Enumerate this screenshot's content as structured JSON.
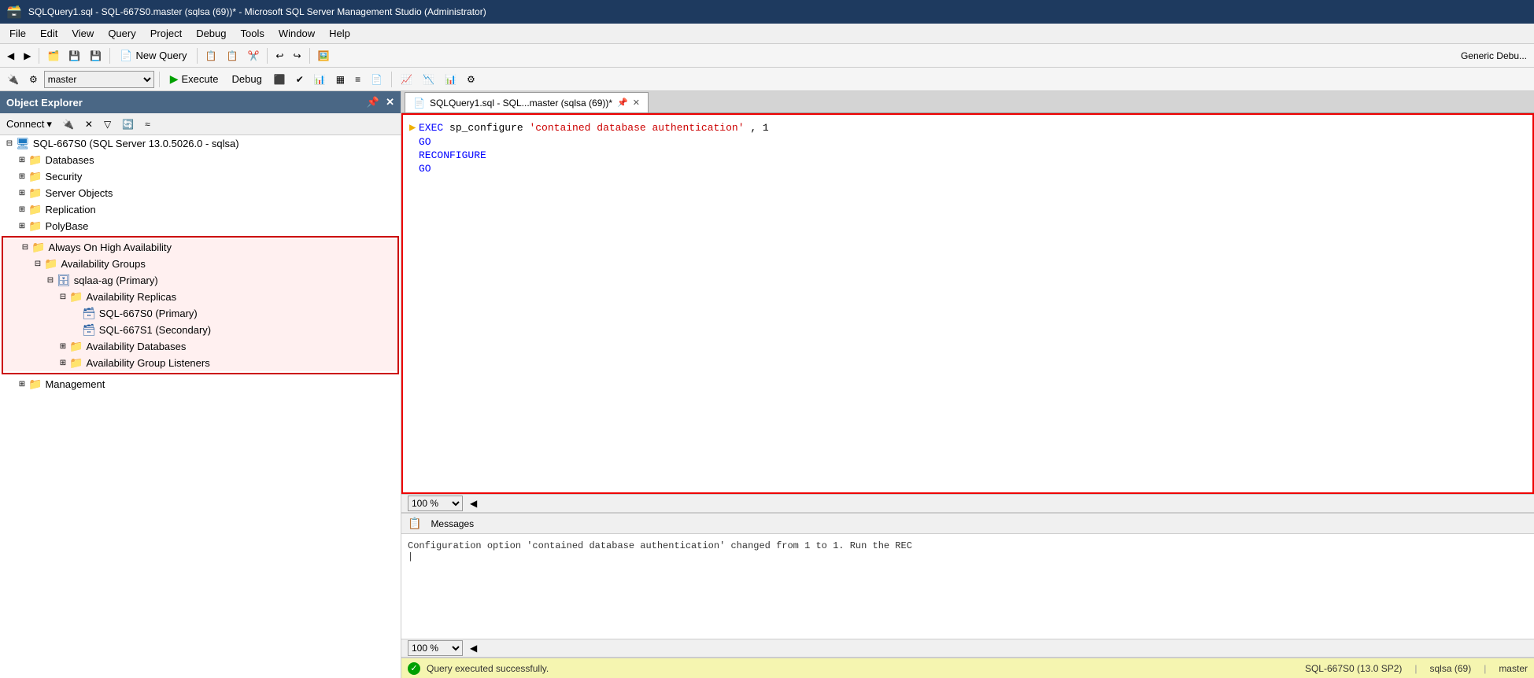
{
  "titleBar": {
    "text": "SQLQuery1.sql - SQL-667S0.master (sqlsa (69))* - Microsoft SQL Server Management Studio (Administrator)"
  },
  "menuBar": {
    "items": [
      "File",
      "Edit",
      "View",
      "Query",
      "Project",
      "Debug",
      "Tools",
      "Window",
      "Help"
    ]
  },
  "toolbar1": {
    "newQueryLabel": "New Query",
    "genericDebug": "Generic Debu..."
  },
  "toolbar2": {
    "database": "master",
    "executeLabel": "Execute",
    "debugLabel": "Debug"
  },
  "objectExplorer": {
    "title": "Object Explorer",
    "connectLabel": "Connect",
    "tree": {
      "serverNode": "SQL-667S0 (SQL Server 13.0.5026.0 - sqlsa)",
      "items": [
        {
          "label": "Databases",
          "indent": 2,
          "expanded": false
        },
        {
          "label": "Security",
          "indent": 2,
          "expanded": false
        },
        {
          "label": "Server Objects",
          "indent": 2,
          "expanded": false
        },
        {
          "label": "Replication",
          "indent": 2,
          "expanded": false
        },
        {
          "label": "PolyBase",
          "indent": 2,
          "expanded": false
        },
        {
          "label": "Always On High Availability",
          "indent": 2,
          "expanded": true,
          "highlighted": true
        },
        {
          "label": "Availability Groups",
          "indent": 3,
          "expanded": true,
          "highlighted": true
        },
        {
          "label": "sqlaa-ag (Primary)",
          "indent": 4,
          "expanded": true,
          "highlighted": true
        },
        {
          "label": "Availability Replicas",
          "indent": 5,
          "expanded": true,
          "highlighted": true
        },
        {
          "label": "SQL-667S0 (Primary)",
          "indent": 6,
          "highlighted": true,
          "arrow": true
        },
        {
          "label": "SQL-667S1 (Secondary)",
          "indent": 6,
          "highlighted": true
        },
        {
          "label": "Availability Databases",
          "indent": 5,
          "expanded": false
        },
        {
          "label": "Availability Group Listeners",
          "indent": 5,
          "expanded": false
        },
        {
          "label": "Management",
          "indent": 2,
          "expanded": false
        }
      ]
    }
  },
  "queryTab": {
    "label": "SQLQuery1.sql - SQL...master (sqlsa (69))*"
  },
  "queryEditor": {
    "lines": [
      {
        "indicator": true,
        "content": "EXEC sp_configure 'contained database authentication', 1"
      },
      {
        "indicator": false,
        "content": "GO"
      },
      {
        "indicator": false,
        "content": "RECONFIGURE"
      },
      {
        "indicator": false,
        "content": "GO"
      }
    ]
  },
  "zoom1": {
    "value": "100 %"
  },
  "messagesPanel": {
    "tabLabel": "Messages",
    "content": "Configuration option 'contained database authentication' changed from 1 to 1. Run the REC"
  },
  "zoom2": {
    "value": "100 %"
  },
  "statusBar": {
    "successText": "Query executed successfully.",
    "server": "SQL-667S0 (13.0 SP2)",
    "user": "sqlsa (69)",
    "database": "master"
  }
}
